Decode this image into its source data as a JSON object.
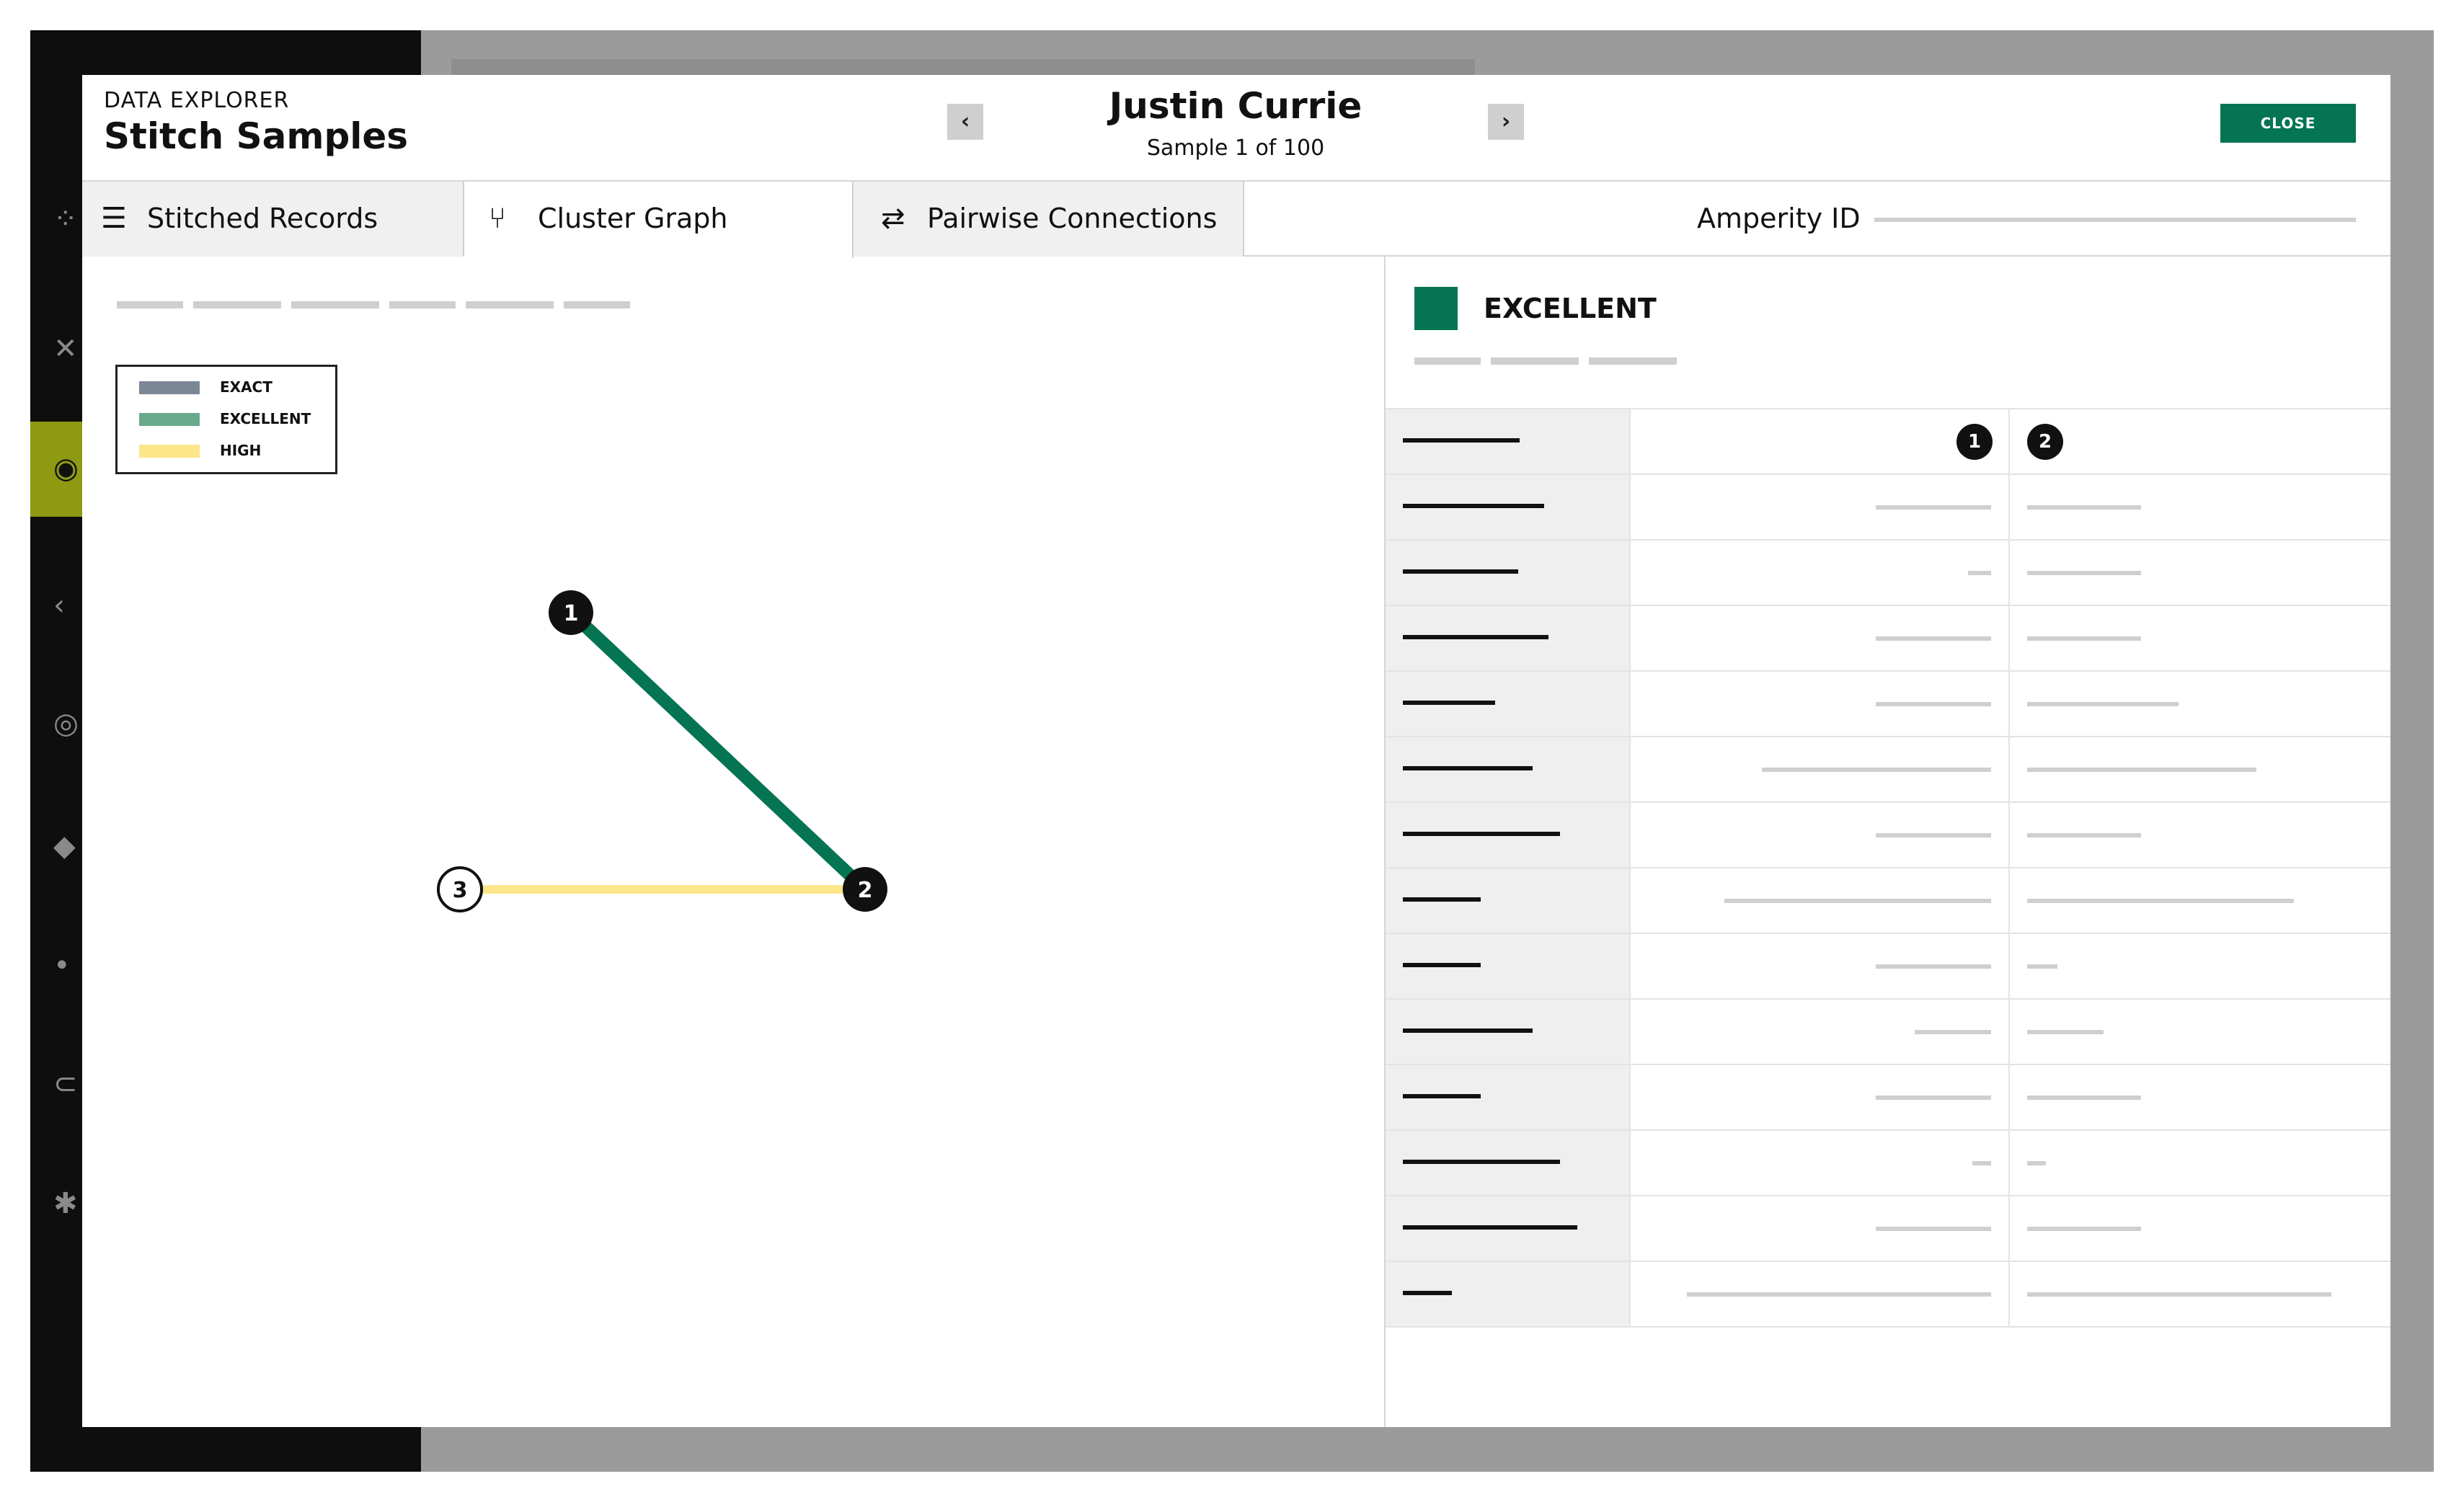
{
  "modal": {
    "eyebrow": "DATA EXPLORER",
    "title": "Stitch Samples",
    "record_name": "Justin Currie",
    "sample_label": "Sample 1 of 100",
    "prev_icon": "chevron-left",
    "next_icon": "chevron-right",
    "close_label": "CLOSE"
  },
  "tabs": [
    {
      "label": "Stitched Records",
      "icon": "list-icon",
      "active": false
    },
    {
      "label": "Cluster Graph",
      "icon": "branch-icon",
      "active": true
    },
    {
      "label": "Pairwise Connections",
      "icon": "swap-arrows-icon",
      "active": false
    }
  ],
  "amperity_id": {
    "label": "Amperity ID",
    "value": ""
  },
  "legend": [
    {
      "label": "EXACT",
      "color": "#7b8794"
    },
    {
      "label": "EXCELLENT",
      "color": "#6aaa8c"
    },
    {
      "label": "HIGH",
      "color": "#fde68a"
    }
  ],
  "graph": {
    "nodes": [
      {
        "id": "1",
        "filled": true
      },
      {
        "id": "2",
        "filled": true
      },
      {
        "id": "3",
        "filled": false
      }
    ],
    "edges": [
      {
        "from": "1",
        "to": "2",
        "tier": "EXCELLENT",
        "color": "#047452"
      },
      {
        "from": "3",
        "to": "2",
        "tier": "HIGH",
        "color": "#fde68a"
      }
    ]
  },
  "detail": {
    "tier": "EXCELLENT",
    "tier_color": "#047452",
    "columns": [
      "1",
      "2"
    ]
  },
  "colors": {
    "accent": "#047452",
    "sidebar_active": "#8e9a11",
    "sidebar_bg": "#0e0e0e"
  }
}
